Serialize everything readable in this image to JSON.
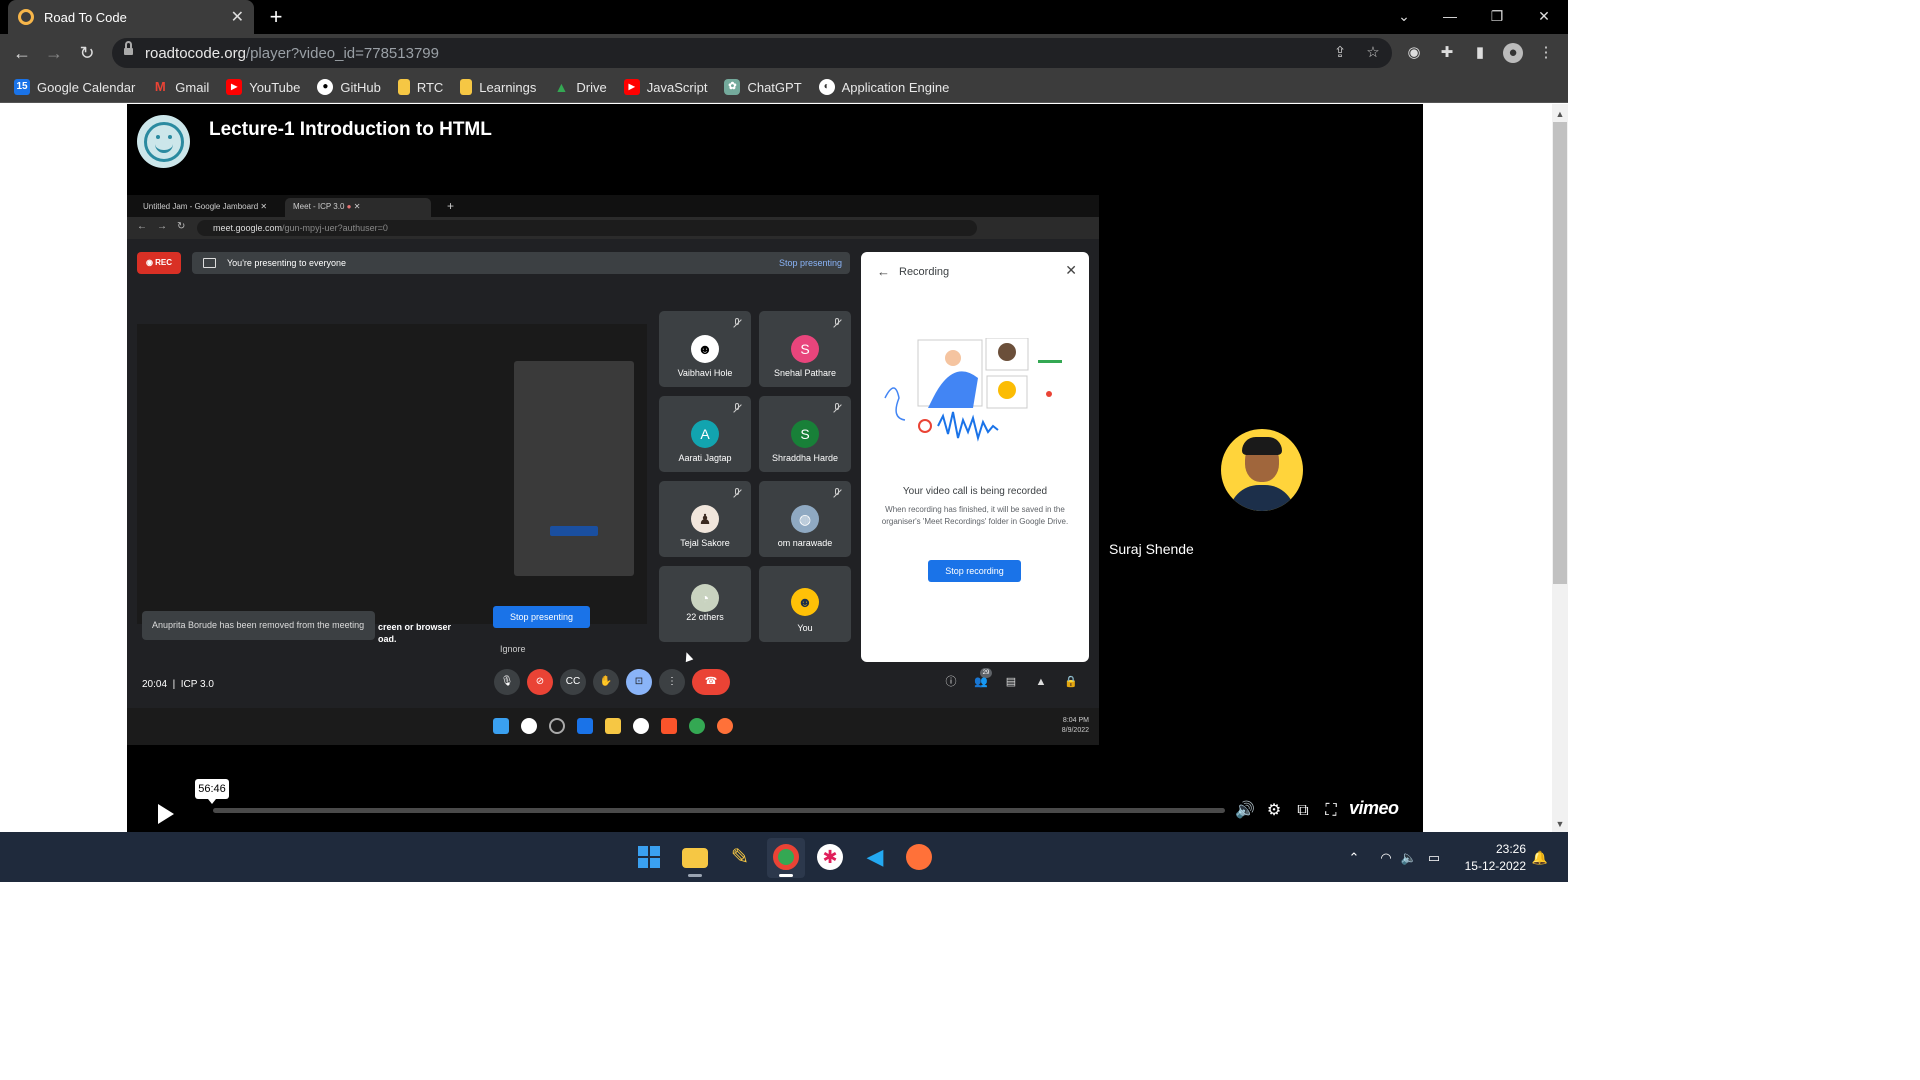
{
  "browser": {
    "tab_title": "Road To Code",
    "url_host": "roadtocode.org",
    "url_path": "/player?video_id=778513799",
    "bookmarks": [
      {
        "label": "Google Calendar",
        "icon": "calendar-icon",
        "color": "#1a73e8"
      },
      {
        "label": "Gmail",
        "icon": "gmail-icon",
        "color": "#ea4335"
      },
      {
        "label": "YouTube",
        "icon": "youtube-icon",
        "color": "#ff0000"
      },
      {
        "label": "GitHub",
        "icon": "github-icon",
        "color": "#ffffff"
      },
      {
        "label": "RTC",
        "icon": "folder-icon",
        "color": "#f6c744"
      },
      {
        "label": "Learnings",
        "icon": "folder-icon",
        "color": "#f6c744"
      },
      {
        "label": "Drive",
        "icon": "drive-icon",
        "color": "#34a853"
      },
      {
        "label": "JavaScript",
        "icon": "youtube-icon",
        "color": "#ff0000"
      },
      {
        "label": "ChatGPT",
        "icon": "chatgpt-icon",
        "color": "#74aa9c"
      },
      {
        "label": "Application Engine",
        "icon": "globe-icon",
        "color": "#ffffff"
      }
    ]
  },
  "video": {
    "title": "Lecture-1 Introduction to HTML",
    "timestamp_tooltip": "56:46",
    "brand": "vimeo",
    "presenter_name": "Suraj Shende",
    "progress_fraction": 0
  },
  "meet": {
    "tab1": "Untitled Jam - Google Jamboard",
    "tab2": "Meet - ICP 3.0",
    "url_host": "meet.google.com",
    "url_path": "/gun-mpyj-uer?authuser=0",
    "rec": "REC",
    "presenting_text": "You're presenting to everyone",
    "stop_presenting_link": "Stop presenting",
    "toast": "Anuprita Borude has been removed from the meeting",
    "screen_text_1": "creen or browser",
    "screen_text_2": "oad.",
    "stop_presenting_btn": "Stop presenting",
    "ignore": "Ignore",
    "participants": [
      {
        "name": "Vaibhavi Hole",
        "initial": "",
        "color": "#ffffff"
      },
      {
        "name": "Snehal Pathare",
        "initial": "S",
        "color": "#e8457c"
      },
      {
        "name": "Aarati Jagtap",
        "initial": "A",
        "color": "#12a4af"
      },
      {
        "name": "Shraddha Harde",
        "initial": "S",
        "color": "#188038"
      },
      {
        "name": "Tejal Sakore",
        "initial": "",
        "color": "#f1e6dc"
      },
      {
        "name": "om narawade",
        "initial": "",
        "color": "#8fa9c2"
      },
      {
        "name": "22 others",
        "initial": "",
        "color": "#c9d3c0"
      },
      {
        "name": "You",
        "initial": "",
        "color": "#ffc107"
      }
    ],
    "panel_title": "Recording",
    "panel_heading": "Your video call is being recorded",
    "panel_body": "When recording has finished, it will be saved in the organiser's 'Meet Recordings' folder in Google Drive.",
    "panel_button": "Stop recording",
    "time": "20:04",
    "meeting_name": "ICP 3.0",
    "participant_badge": "29",
    "inner_clock_time": "8:04 PM",
    "inner_clock_date": "8/9/2022"
  },
  "taskbar": {
    "time": "23:26",
    "date": "15-12-2022"
  }
}
